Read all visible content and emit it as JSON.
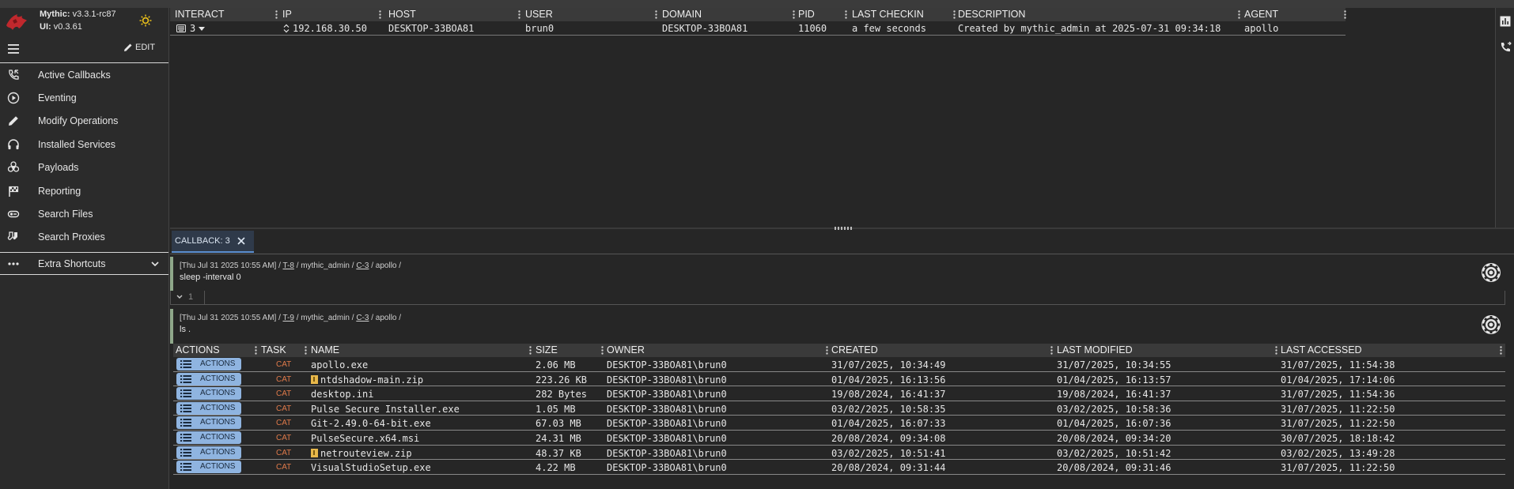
{
  "app": {
    "version_label": "Mythic:",
    "version": "v3.3.1-rc87",
    "ui_label": "UI:",
    "ui_version": "v0.3.61",
    "edit_label": "EDIT"
  },
  "sidebar": {
    "items": [
      {
        "label": "Active Callbacks",
        "icon": "phone-callback-icon"
      },
      {
        "label": "Eventing",
        "icon": "play-circle-icon"
      },
      {
        "label": "Modify Operations",
        "icon": "pencil-icon"
      },
      {
        "label": "Installed Services",
        "icon": "headphones-icon"
      },
      {
        "label": "Payloads",
        "icon": "biohazard-icon"
      },
      {
        "label": "Reporting",
        "icon": "flag-icon"
      },
      {
        "label": "Search Files",
        "icon": "file-search-icon"
      },
      {
        "label": "Search Proxies",
        "icon": "socks-icon"
      }
    ],
    "extra_label": "Extra Shortcuts"
  },
  "callbacks": {
    "headers": [
      "INTERACT",
      "IP",
      "HOST",
      "USER",
      "DOMAIN",
      "PID",
      "LAST CHECKIN",
      "DESCRIPTION",
      "AGENT"
    ],
    "rows": [
      {
        "interact": "3",
        "ip": "192.168.30.50",
        "host": "DESKTOP-33BOA81",
        "user": "brun0",
        "domain": "DESKTOP-33BOA81",
        "pid": "11060",
        "last_checkin": "a few seconds",
        "description": "Created by mythic_admin at 2025-07-31 09:34:18",
        "agent": "apollo"
      }
    ]
  },
  "tab": {
    "label": "CALLBACK: 3"
  },
  "tasks": [
    {
      "timestamp": "[Thu Jul 31 2025 10:55 AM]",
      "task_id": "T-8",
      "operator": "mythic_admin",
      "callback": "C-3",
      "agent": "apollo",
      "command": "sleep -interval 0",
      "line_number": "1"
    },
    {
      "timestamp": "[Thu Jul 31 2025 10:55 AM]",
      "task_id": "T-9",
      "operator": "mythic_admin",
      "callback": "C-3",
      "agent": "apollo",
      "command": "ls ."
    }
  ],
  "separator": "/",
  "files": {
    "headers": [
      "ACTIONS",
      "TASK",
      "NAME",
      "SIZE",
      "OWNER",
      "CREATED",
      "LAST MODIFIED",
      "LAST ACCESSED"
    ],
    "action_label": "ACTIONS",
    "task_label": "CAT",
    "rows": [
      {
        "name": "apollo.exe",
        "zip": false,
        "size": "2.06 MB",
        "owner": "DESKTOP-33BOA81\\brun0",
        "created": "31/07/2025, 10:34:49",
        "modified": "31/07/2025, 10:34:55",
        "accessed": "31/07/2025, 11:54:38"
      },
      {
        "name": "ntdshadow-main.zip",
        "zip": true,
        "size": "223.26 KB",
        "owner": "DESKTOP-33BOA81\\brun0",
        "created": "01/04/2025, 16:13:56",
        "modified": "01/04/2025, 16:13:57",
        "accessed": "01/04/2025, 17:14:06"
      },
      {
        "name": "desktop.ini",
        "zip": false,
        "size": "282 Bytes",
        "owner": "DESKTOP-33BOA81\\brun0",
        "created": "19/08/2024, 16:41:37",
        "modified": "19/08/2024, 16:41:37",
        "accessed": "31/07/2025, 11:54:36"
      },
      {
        "name": "Pulse Secure Installer.exe",
        "zip": false,
        "size": "1.05 MB",
        "owner": "DESKTOP-33BOA81\\brun0",
        "created": "03/02/2025, 10:58:35",
        "modified": "03/02/2025, 10:58:36",
        "accessed": "31/07/2025, 11:22:50"
      },
      {
        "name": "Git-2.49.0-64-bit.exe",
        "zip": false,
        "size": "67.03 MB",
        "owner": "DESKTOP-33BOA81\\brun0",
        "created": "01/04/2025, 16:07:33",
        "modified": "01/04/2025, 16:07:36",
        "accessed": "31/07/2025, 11:22:50"
      },
      {
        "name": "PulseSecure.x64.msi",
        "zip": false,
        "size": "24.31 MB",
        "owner": "DESKTOP-33BOA81\\brun0",
        "created": "20/08/2024, 09:34:08",
        "modified": "20/08/2024, 09:34:20",
        "accessed": "30/07/2025, 18:18:42"
      },
      {
        "name": "netrouteview.zip",
        "zip": true,
        "size": "48.37 KB",
        "owner": "DESKTOP-33BOA81\\brun0",
        "created": "03/02/2025, 10:51:41",
        "modified": "03/02/2025, 10:51:42",
        "accessed": "03/02/2025, 13:49:28"
      },
      {
        "name": "VisualStudioSetup.exe",
        "zip": false,
        "size": "4.22 MB",
        "owner": "DESKTOP-33BOA81\\brun0",
        "created": "20/08/2024, 09:31:44",
        "modified": "20/08/2024, 09:31:46",
        "accessed": "31/07/2025, 11:22:50"
      }
    ]
  },
  "colors": {
    "accent": "#8fb4e0",
    "cat": "#e07a4a",
    "task_border": "#8fa88a",
    "logo": "#c0282d"
  }
}
